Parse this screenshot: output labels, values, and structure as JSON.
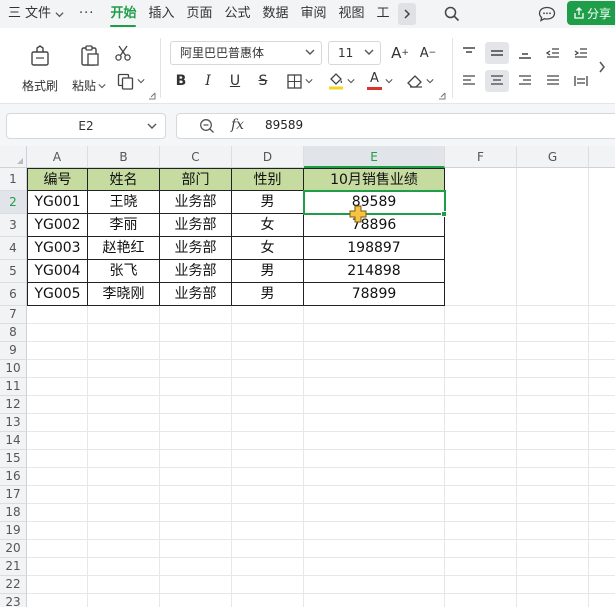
{
  "menubar": {
    "menu_icon_label": "三",
    "file_label": "文件",
    "more_label": "···",
    "tabs": [
      {
        "label": "开始",
        "active": true
      },
      {
        "label": "插入",
        "active": false
      },
      {
        "label": "页面",
        "active": false
      },
      {
        "label": "公式",
        "active": false
      },
      {
        "label": "数据",
        "active": false
      },
      {
        "label": "审阅",
        "active": false
      },
      {
        "label": "视图",
        "active": false
      },
      {
        "label": "工",
        "active": false
      }
    ],
    "share_label": "分享"
  },
  "ribbon": {
    "format_painter_label": "格式刷",
    "paste_label": "粘贴",
    "font_name": "阿里巴巴普惠体",
    "font_size": "11",
    "bold": "B",
    "italic": "I",
    "underline": "U",
    "strike": "S",
    "grow_font": "A",
    "shrink_font": "A",
    "font_color": "A"
  },
  "formula_bar": {
    "cell_ref": "E2",
    "fx_label": "fx",
    "value": "89589"
  },
  "sheet": {
    "columns": [
      "A",
      "B",
      "C",
      "D",
      "E",
      "F",
      "G"
    ],
    "selected_column": "E",
    "rows": [
      "1",
      "2",
      "3",
      "4",
      "5",
      "6",
      "7",
      "8",
      "9",
      "10",
      "11",
      "12",
      "13",
      "14",
      "15",
      "16",
      "17",
      "18",
      "19",
      "20",
      "21",
      "22",
      "23"
    ],
    "selected_row": "2",
    "header": [
      "编号",
      "姓名",
      "部门",
      "性别",
      "10月销售业绩"
    ],
    "data": [
      [
        "YG001",
        "王晓",
        "业务部",
        "男",
        "89589"
      ],
      [
        "YG002",
        "李丽",
        "业务部",
        "女",
        "78896"
      ],
      [
        "YG003",
        "赵艳红",
        "业务部",
        "女",
        "198897"
      ],
      [
        "YG004",
        "张飞",
        "业务部",
        "男",
        "214898"
      ],
      [
        "YG005",
        "李晓刚",
        "业务部",
        "男",
        "78899"
      ]
    ]
  },
  "colors": {
    "accent": "#1f9e4a",
    "header_fill": "#c6dba0",
    "font_color_bar": "#d9342b"
  }
}
